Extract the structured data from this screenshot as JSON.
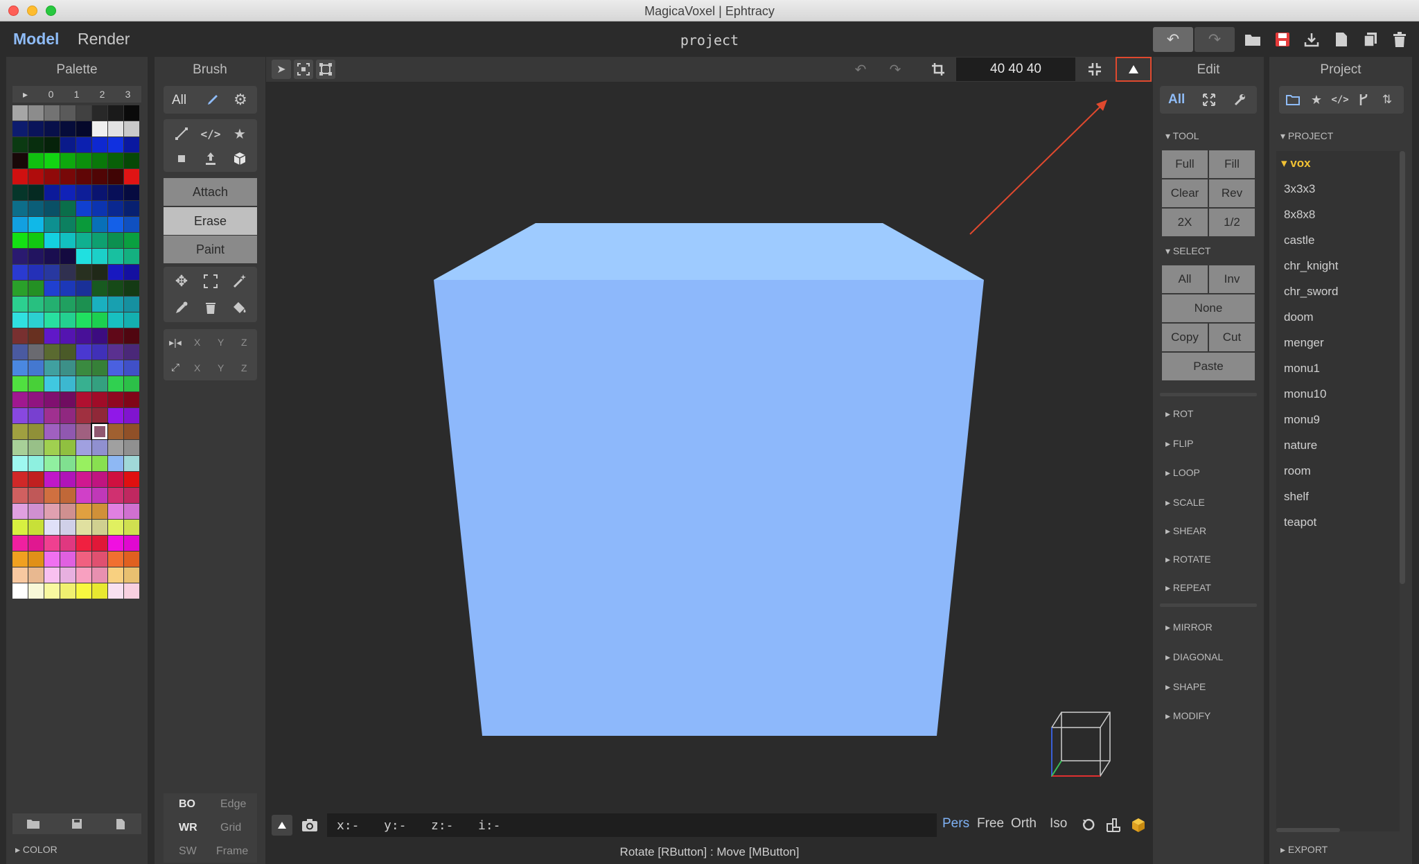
{
  "window": {
    "title": "MagicaVoxel | Ephtracy"
  },
  "menu": {
    "model_tab": "Model",
    "render_tab": "Render",
    "project_name": "project"
  },
  "colors": {
    "accent": "#7fb2f5",
    "cube_top": "#9ecbff",
    "cube_front": "#8db8fb",
    "highlight_box": "#e0492e"
  },
  "palette": {
    "title": "Palette",
    "tabs": [
      "▸",
      "0",
      "1",
      "2",
      "3"
    ],
    "footer_section": "COLOR",
    "selected_index": 165,
    "colors": [
      "#a6a6a6",
      "#8c8c8c",
      "#737373",
      "#5a5a5a",
      "#414141",
      "#282828",
      "#1a1a1a",
      "#0a0a0a",
      "#0d1c6e",
      "#0a145a",
      "#08104a",
      "#060c3a",
      "#05082a",
      "#f0f0f0",
      "#e2e2e2",
      "#cacaca",
      "#0b3a12",
      "#082e0e",
      "#06220a",
      "#0a1a8a",
      "#0c20b0",
      "#0e28d0",
      "#1030e0",
      "#0a18a0",
      "#180808",
      "#10c010",
      "#12d412",
      "#0ea80e",
      "#0c900c",
      "#0a780a",
      "#086008",
      "#064806",
      "#d01010",
      "#b00c0c",
      "#900a0a",
      "#780808",
      "#600606",
      "#500505",
      "#400404",
      "#e01414",
      "#06362a",
      "#052a22",
      "#0c1a9a",
      "#1022b8",
      "#0e1e98",
      "#0a1470",
      "#080f58",
      "#060b40",
      "#0d6e8a",
      "#0b5e78",
      "#0a5066",
      "#0a6e4a",
      "#1040d0",
      "#0c34b0",
      "#0a2890",
      "#082070",
      "#12a0e0",
      "#10b8e8",
      "#0e9090",
      "#0c8060",
      "#0a9a3a",
      "#0870b8",
      "#1460e8",
      "#1050c0",
      "#14e014",
      "#12c812",
      "#14d0e0",
      "#12c0c0",
      "#10b090",
      "#0ea070",
      "#0c9050",
      "#0aa040",
      "#2a1a70",
      "#221460",
      "#1a0e50",
      "#140a40",
      "#20e0e0",
      "#1cd0c8",
      "#18c0a0",
      "#14b080",
      "#2a3ad0",
      "#2430b8",
      "#2838a0",
      "#303050",
      "#283020",
      "#202818",
      "#1818c0",
      "#1410a0",
      "#2aa02a",
      "#249024",
      "#2040d0",
      "#1c38b8",
      "#1a3098",
      "#185a20",
      "#164a18",
      "#143a14",
      "#2cd090",
      "#28c080",
      "#24b070",
      "#20a060",
      "#1c9050",
      "#1ab0c0",
      "#18a0b0",
      "#1690a0",
      "#30e0e0",
      "#2cd0d0",
      "#28e0a0",
      "#24d090",
      "#20e060",
      "#1cd050",
      "#18c0c0",
      "#14b0b0",
      "#783030",
      "#683020",
      "#6018c8",
      "#5414b0",
      "#481098",
      "#3c0c80",
      "#600818",
      "#500610",
      "#4a5aa0",
      "#6a6a70",
      "#5a6a30",
      "#4a5a28",
      "#4a38d0",
      "#4030b8",
      "#5a3090",
      "#4a2878",
      "#4a88e0",
      "#4478d0",
      "#40a0a0",
      "#3c9088",
      "#3a8a40",
      "#368038",
      "#4a60e0",
      "#4050c8",
      "#50e040",
      "#48d038",
      "#40c8e0",
      "#3cb8d0",
      "#38b090",
      "#34a080",
      "#30d050",
      "#2cc048",
      "#a01890",
      "#901480",
      "#801070",
      "#700c60",
      "#b01030",
      "#a00c28",
      "#900820",
      "#800618",
      "#8848e0",
      "#7840d0",
      "#a03090",
      "#902880",
      "#a03040",
      "#902838",
      "#9018e8",
      "#8014d0",
      "#a0a040",
      "#909038",
      "#a060c0",
      "#9058b0",
      "#a06080",
      "#905870",
      "#a06030",
      "#905028",
      "#a8d098",
      "#98c088",
      "#a0d050",
      "#90c040",
      "#a0a0e0",
      "#9090d0",
      "#a0a0a0",
      "#909090",
      "#9ef8f0",
      "#8ef0e0",
      "#90f0a0",
      "#80e090",
      "#98f060",
      "#88e050",
      "#8eb8f4",
      "#a0d8d8",
      "#d02828",
      "#c02020",
      "#c018c8",
      "#b014b8",
      "#d01890",
      "#c01480",
      "#d01040",
      "#e01010",
      "#d06060",
      "#c05858",
      "#d07040",
      "#c06838",
      "#d040c8",
      "#c038b8",
      "#d03070",
      "#c02860",
      "#e0a0e0",
      "#d090d0",
      "#e0a0b0",
      "#d09090",
      "#e0a040",
      "#d09038",
      "#e080e0",
      "#d070d0",
      "#d8f040",
      "#c8e038",
      "#e0e0f8",
      "#d0d0e8",
      "#e0e0a0",
      "#d0d090",
      "#e0f060",
      "#d0e050",
      "#f020a0",
      "#e01890",
      "#f04090",
      "#e03880",
      "#f02040",
      "#e01838",
      "#f010e0",
      "#e008d0",
      "#f0a020",
      "#e09018",
      "#f070f0",
      "#e060e0",
      "#f06080",
      "#e05070",
      "#f07030",
      "#e06020",
      "#f8c8a0",
      "#e8b890",
      "#f8c0f0",
      "#e8b0e0",
      "#f8a0c0",
      "#e890b0",
      "#f8d080",
      "#e8c070",
      "#ffffff",
      "#f8f8d8",
      "#f8f8a0",
      "#f0f070",
      "#f8f840",
      "#e8e830",
      "#f8e0f0",
      "#f8d0e0"
    ]
  },
  "brush": {
    "title": "Brush",
    "all_label": "All",
    "modes": [
      "Attach",
      "Erase",
      "Paint"
    ],
    "axis_labels": [
      "X",
      "Y",
      "Z"
    ],
    "bottom_options": [
      [
        "BO",
        "Edge"
      ],
      [
        "WR",
        "Grid"
      ],
      [
        "SW",
        "Frame"
      ]
    ]
  },
  "viewport": {
    "size_readout": "40  40  40",
    "coords": {
      "x": "x:-",
      "y": "y:-",
      "z": "z:-",
      "i": "i:-"
    },
    "view_modes": [
      "Pers",
      "Free",
      "Orth",
      "Iso"
    ],
    "active_view": "Pers"
  },
  "status_bar": {
    "text": "Rotate [RButton] : Move [MButton]"
  },
  "edit": {
    "title": "Edit",
    "all_label": "All",
    "tool_section": "TOOL",
    "tool_buttons": [
      [
        "Full",
        "Fill"
      ],
      [
        "Clear",
        "Rev"
      ],
      [
        "2X",
        "1/2"
      ]
    ],
    "select_section": "SELECT",
    "select_buttons": {
      "all": "All",
      "inv": "Inv",
      "none": "None",
      "copy": "Copy",
      "cut": "Cut",
      "paste": "Paste"
    },
    "sections_a": [
      "ROT",
      "FLIP",
      "LOOP",
      "SCALE",
      "SHEAR",
      "ROTATE",
      "REPEAT"
    ],
    "sections_b": [
      "MIRROR",
      "DIAGONAL",
      "SHAPE",
      "MODIFY"
    ]
  },
  "project_panel": {
    "title": "Project",
    "section": "PROJECT",
    "folder": "vox",
    "items": [
      "3x3x3",
      "8x8x8",
      "castle",
      "chr_knight",
      "chr_sword",
      "doom",
      "menger",
      "monu1",
      "monu10",
      "monu9",
      "nature",
      "room",
      "shelf",
      "teapot"
    ],
    "export_section": "EXPORT"
  }
}
